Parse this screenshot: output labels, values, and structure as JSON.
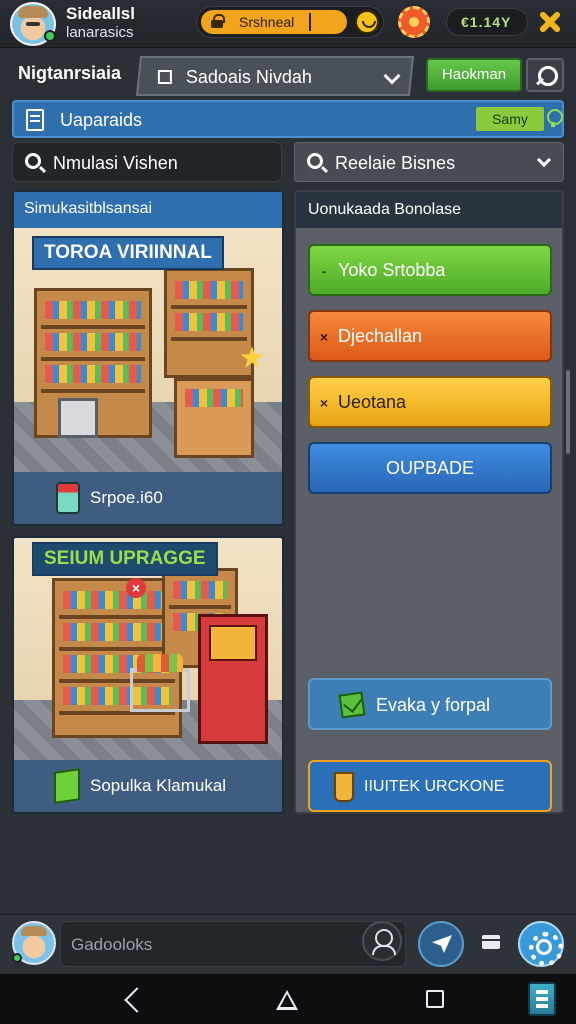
{
  "header": {
    "user_name": "Sideallsl",
    "user_subtitle": "lanarasics",
    "search_text": "Srshneal",
    "currency": "€1.14Y"
  },
  "nav": {
    "title": "Nigtanrsiaia",
    "selector": "Sadoais Nivdah",
    "upgrade_label": "Haokman"
  },
  "section": {
    "title": "Uaparaids",
    "save_label": "Samy"
  },
  "filters": {
    "search_value": "Nmulasi Vishen",
    "select_value": "Reelaie Bisnes"
  },
  "cards": [
    {
      "header": "Simukasitblsansai",
      "banner": "TOROA VIRIINNAL",
      "footer": "Srpoe.i60"
    },
    {
      "header": "",
      "banner": "SEIUM UPRAGGE",
      "footer": "Sopulka Klamukal"
    }
  ],
  "panel": {
    "title": "Uonukaada Bonolase",
    "options": [
      {
        "mark": "-",
        "label": "Yoko Srtobba",
        "color": "#62c63a"
      },
      {
        "mark": "×",
        "label": "Djechallan",
        "color": "#ee6f26"
      },
      {
        "mark": "×",
        "label": "Ueotana",
        "color": "#f5bb2a"
      }
    ],
    "upgrade_label": "OUPBADE",
    "action_label": "Evaka y forpal",
    "final_label": "IIUITEK URCKONE"
  },
  "chat": {
    "placeholder": "Gadooloks"
  },
  "colors": {
    "primary_blue": "#2f6fae",
    "accent_orange": "#f2a51c",
    "green": "#62c63a",
    "background": "#2b2f36"
  },
  "icons": [
    "avatar",
    "lock-icon",
    "smile-icon",
    "gear-icon",
    "close-icon",
    "wrench-icon",
    "document-icon",
    "bulb-icon",
    "search-icon",
    "chevron-down-icon",
    "can-icon",
    "box-icon",
    "mail-icon",
    "cup-icon",
    "user-search-icon",
    "send-icon",
    "card-icon",
    "settings-icon",
    "back-icon",
    "home-icon",
    "recents-icon",
    "app-icon"
  ]
}
